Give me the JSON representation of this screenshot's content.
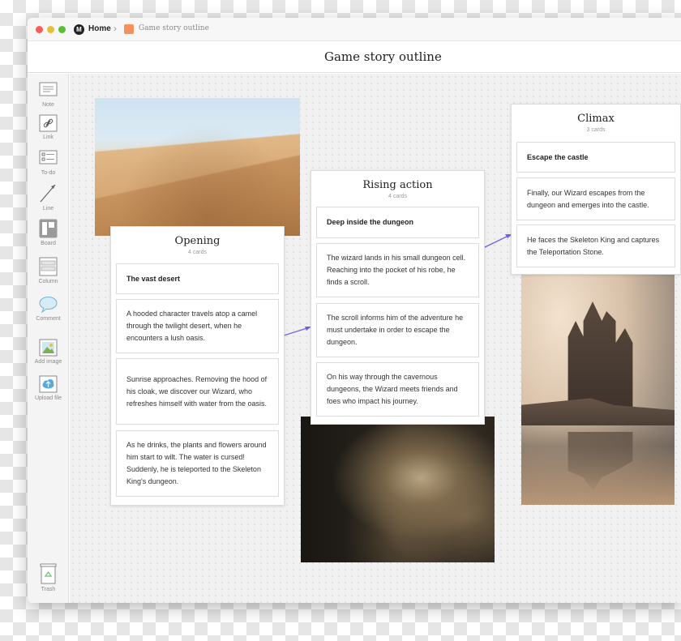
{
  "breadcrumb": {
    "home": "Home",
    "board": "Game story outline",
    "board_chip_color": "#f7905a"
  },
  "page_title": "Game story outline",
  "toolbar": {
    "items": [
      {
        "label": "Note",
        "icon": "note-icon"
      },
      {
        "label": "Link",
        "icon": "link-icon"
      },
      {
        "label": "To-do",
        "icon": "todo-icon"
      },
      {
        "label": "Line",
        "icon": "line-icon"
      },
      {
        "label": "Board",
        "icon": "board-icon"
      },
      {
        "label": "Column",
        "icon": "column-icon"
      },
      {
        "label": "Comment",
        "icon": "comment-icon"
      },
      {
        "label": "Add image",
        "icon": "add-image-icon"
      },
      {
        "label": "Upload file",
        "icon": "upload-file-icon"
      }
    ],
    "trash": {
      "label": "Trash",
      "icon": "trash-icon"
    }
  },
  "columns": [
    {
      "title": "Opening",
      "count": "4 cards",
      "cards": [
        "The vast desert",
        "A hooded character travels atop a camel through the twilight desert, when he encounters a lush oasis.",
        "Sunrise approaches. Removing the hood of his cloak, we discover our Wizard, who refreshes himself with water from the oasis.",
        "As he drinks, the plants and flowers around him start to wilt. The water is cursed! Suddenly, he is teleported to the Skeleton King's dungeon."
      ]
    },
    {
      "title": "Rising action",
      "count": "4 cards",
      "cards": [
        "Deep inside the dungeon",
        "The wizard lands in his small dungeon cell. Reaching into the pocket of his robe, he finds a scroll.",
        "The scroll informs him of the adventure he must undertake in order to escape the dungeon.",
        "On his way through the cavernous dungeons, the Wizard meets friends and foes who impact his journey."
      ]
    },
    {
      "title": "Climax",
      "count": "3 cards",
      "cards": [
        "Escape the castle",
        "Finally, our Wizard escapes from the dungeon and emerges into the castle.",
        "He faces the Skeleton King and captures the Teleportation Stone."
      ]
    }
  ],
  "images": [
    "desert-image",
    "catacomb-image",
    "castle-image"
  ],
  "colors": {
    "arrow": "#7b5ce6",
    "traffic_red": "#fc5b57",
    "traffic_yellow": "#e5bf3c",
    "traffic_green": "#57c038"
  }
}
